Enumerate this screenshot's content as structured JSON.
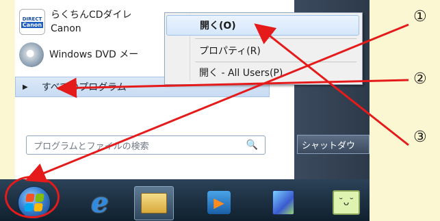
{
  "programs": [
    {
      "icon": "direct-canon-icon",
      "badge_line1": "DIRECT",
      "badge_line2": "Canon",
      "line1": "らくちんCDダイレ",
      "line2": "Canon"
    },
    {
      "icon": "windows-dvd-maker-icon",
      "line1": "Windows DVD メー"
    }
  ],
  "all_programs": {
    "label": "すべてのプログラム"
  },
  "search": {
    "placeholder": "プログラムとファイルの検索"
  },
  "shutdown": {
    "label": "シャットダウ"
  },
  "context_menu": {
    "items": [
      {
        "label": "開く(O)",
        "selected": true
      },
      {
        "label": "プロパティ(R)"
      },
      {
        "label": "開く - All Users(P)"
      }
    ]
  },
  "annotations": {
    "n1": "①",
    "n2": "②",
    "n3": "③"
  },
  "colors": {
    "accent_red": "#e51b1b",
    "background": "#fbf7d2"
  }
}
